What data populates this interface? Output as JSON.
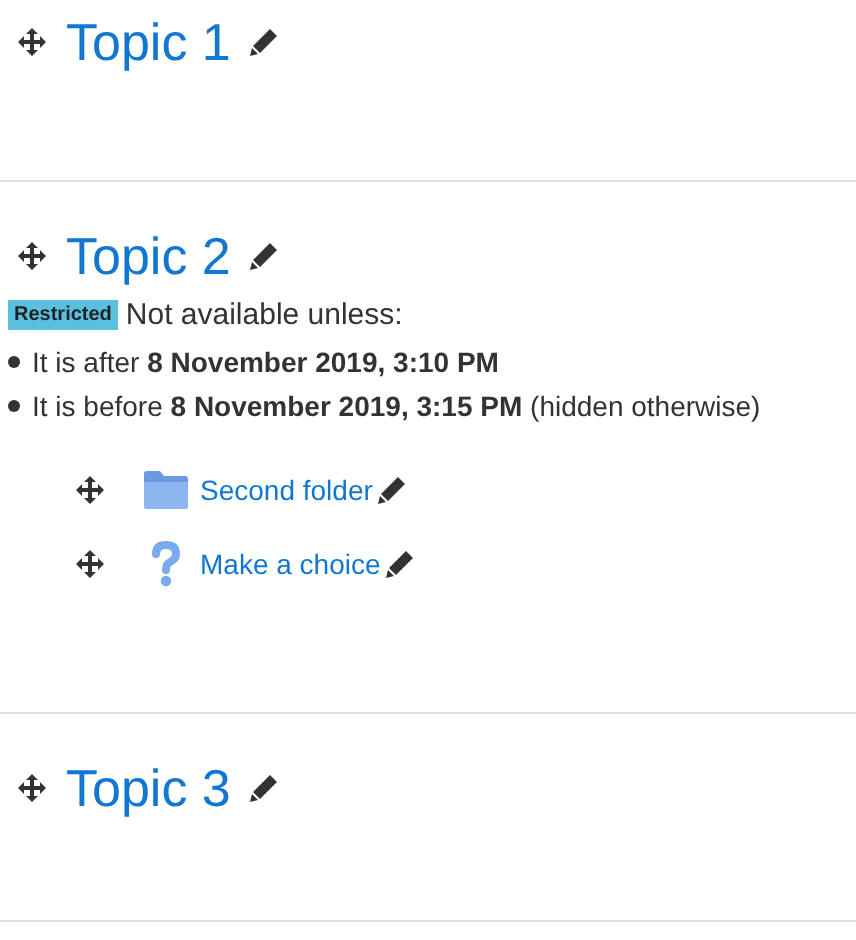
{
  "sections": [
    {
      "title": "Topic 1"
    },
    {
      "title": "Topic 2",
      "restriction": {
        "badge": "Restricted",
        "intro": "Not available unless:",
        "conditions": [
          "It is after **8 November 2019, 3:10 PM**",
          "It is before **8 November 2019, 3:15 PM** (hidden otherwise)"
        ]
      },
      "activities": [
        {
          "kind": "folder",
          "name": "Second folder"
        },
        {
          "kind": "choice",
          "name": "Make a choice"
        }
      ]
    },
    {
      "title": "Topic 3"
    }
  ]
}
